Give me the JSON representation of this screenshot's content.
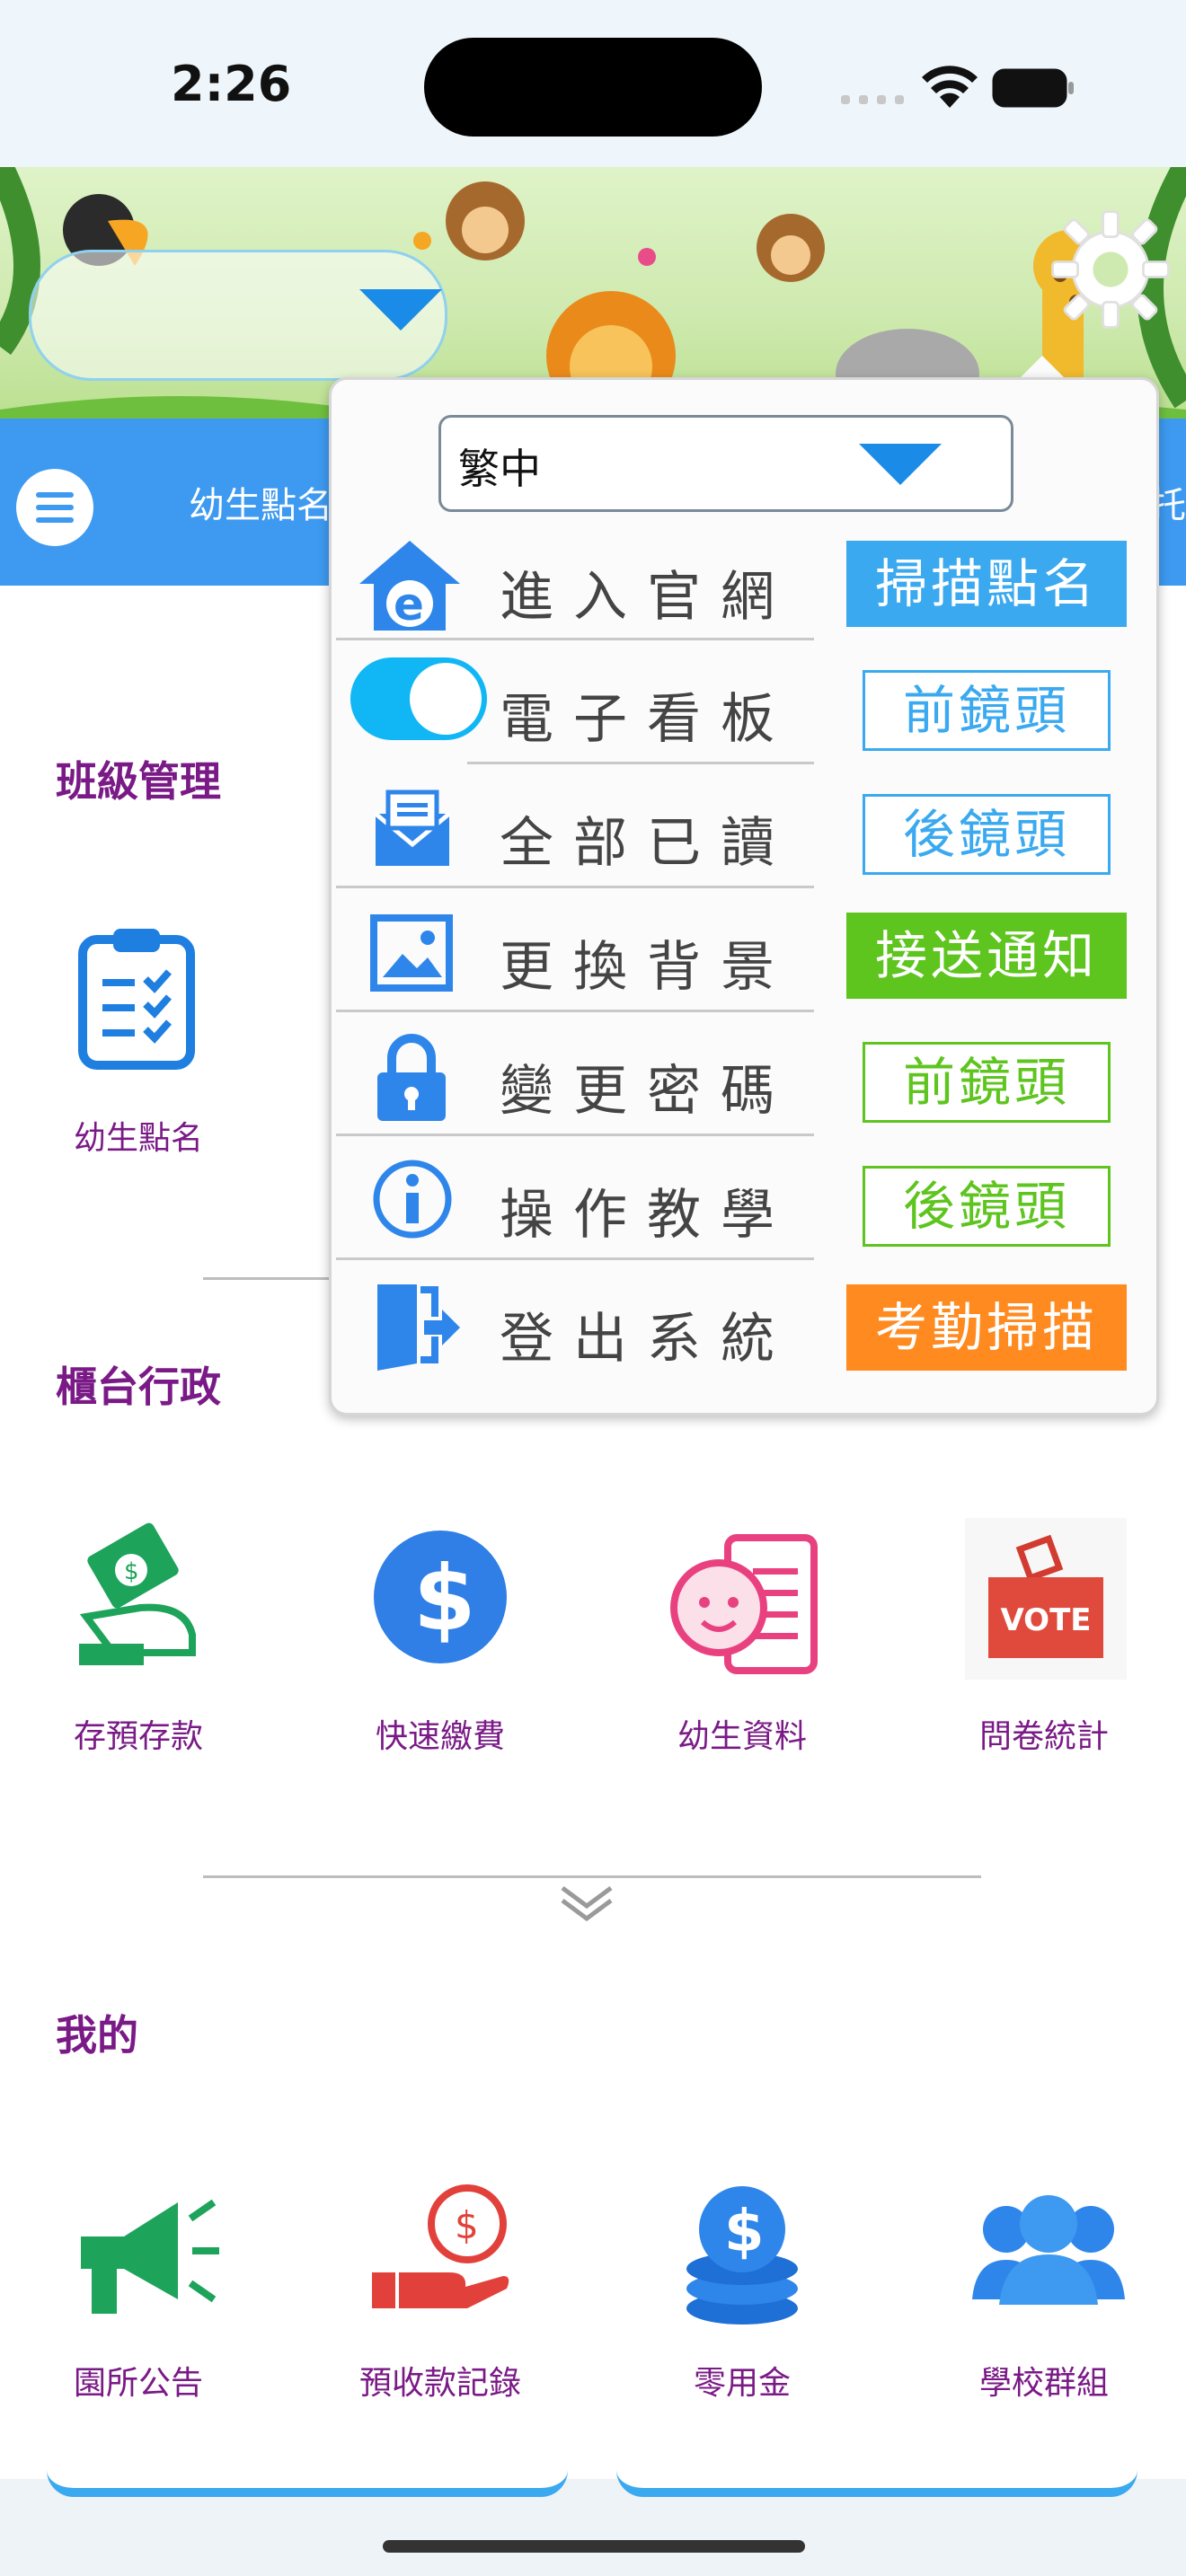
{
  "status_bar": {
    "time": "2:26"
  },
  "header": {
    "nav_title": "幼生點名",
    "nav_right_partial": "托"
  },
  "popup": {
    "language": "繁中",
    "rows": [
      {
        "label": "進入官網",
        "icon": "home-ie-icon"
      },
      {
        "label": "電子看板",
        "icon": "toggle-switch"
      },
      {
        "label": "全部已讀",
        "icon": "mail-icon"
      },
      {
        "label": "更換背景",
        "icon": "image-icon"
      },
      {
        "label": "變更密碼",
        "icon": "lock-icon"
      },
      {
        "label": "操作教學",
        "icon": "info-icon"
      },
      {
        "label": "登出系統",
        "icon": "logout-icon"
      }
    ],
    "buttons": [
      {
        "label": "掃描點名",
        "style": "filled",
        "color": "#3aa9ef"
      },
      {
        "label": "前鏡頭",
        "style": "outline",
        "color": "#3aa9ef"
      },
      {
        "label": "後鏡頭",
        "style": "outline",
        "color": "#3aa9ef"
      },
      {
        "label": "接送通知",
        "style": "filled",
        "color": "#5ec41e"
      },
      {
        "label": "前鏡頭",
        "style": "outline",
        "color": "#5ec41e"
      },
      {
        "label": "後鏡頭",
        "style": "outline",
        "color": "#5ec41e"
      },
      {
        "label": "考勤掃描",
        "style": "filled",
        "color": "#ff8a1f"
      }
    ],
    "toggle_on": true
  },
  "sections": {
    "class_management": {
      "title": "班級管理",
      "apps": [
        {
          "label": "幼生點名",
          "icon": "clipboard-check-icon"
        }
      ]
    },
    "front_desk": {
      "title": "櫃台行政",
      "apps": [
        {
          "label": "存預存款",
          "icon": "money-hand-icon"
        },
        {
          "label": "快速繳費",
          "icon": "dollar-coin-icon"
        },
        {
          "label": "幼生資料",
          "icon": "baby-profile-icon"
        },
        {
          "label": "問卷統計",
          "icon": "vote-box-icon"
        }
      ],
      "vote_text": "VOTE"
    },
    "mine": {
      "title": "我的",
      "apps": [
        {
          "label": "園所公告",
          "icon": "megaphone-icon"
        },
        {
          "label": "預收款記錄",
          "icon": "hand-coin-icon"
        },
        {
          "label": "零用金",
          "icon": "coin-stack-icon"
        },
        {
          "label": "學校群組",
          "icon": "group-icon"
        }
      ]
    }
  },
  "colors": {
    "accent_blue": "#3d9af0",
    "section_purple": "#7a1a86"
  }
}
